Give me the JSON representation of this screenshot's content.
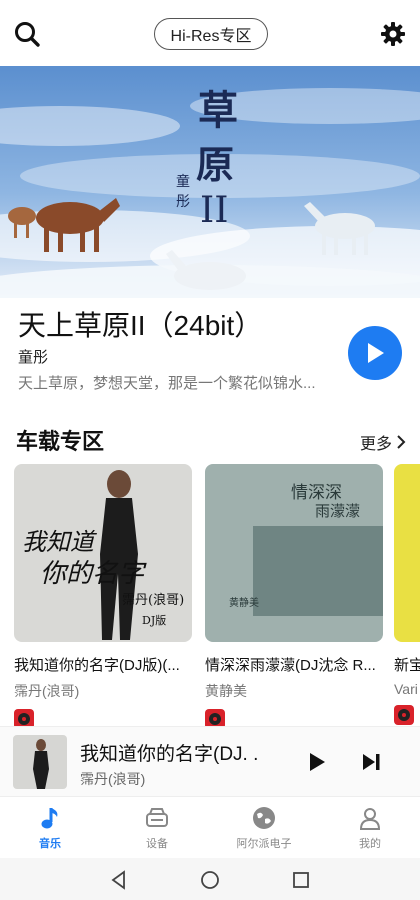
{
  "header": {
    "hires_label": "Hi-Res专区",
    "search_icon": "search-icon",
    "settings_icon": "gear-icon"
  },
  "hero": {
    "title": "天上草原II（24bit）",
    "artist": "童彤",
    "description": "天上草原，梦想天堂，那是一个繁花似锦水...",
    "accent": "#1e7cf2",
    "banner_title": "草原",
    "banner_numeral": "II",
    "banner_artist": "童彤"
  },
  "section": {
    "title": "车载专区",
    "more_label": "更多"
  },
  "cards": [
    {
      "title": "我知道你的名字(DJ版)(...",
      "artist": "霈丹(浪哥)",
      "cover_text_1": "我知道",
      "cover_text_2": "你的名字",
      "cover_text_3": "霈丹(浪哥)",
      "cover_text_4": "DJ版"
    },
    {
      "title": "情深深雨濛濛(DJ沈念 R...",
      "artist": "黄静美",
      "cover_text_1": "情深深",
      "cover_text_2": "雨濛濛",
      "cover_text_3": "黄静美"
    },
    {
      "title": "新宝",
      "artist": "Vari"
    }
  ],
  "mini_player": {
    "title": "我知道你的名字(DJ. .",
    "artist": "霈丹(浪哥)"
  },
  "tabs": [
    {
      "label": "音乐",
      "icon": "music-note-icon",
      "active": true
    },
    {
      "label": "设备",
      "icon": "car-device-icon",
      "active": false
    },
    {
      "label": "阿尔派电子",
      "icon": "globe-icon",
      "active": false
    },
    {
      "label": "我的",
      "icon": "user-icon",
      "active": false
    }
  ]
}
